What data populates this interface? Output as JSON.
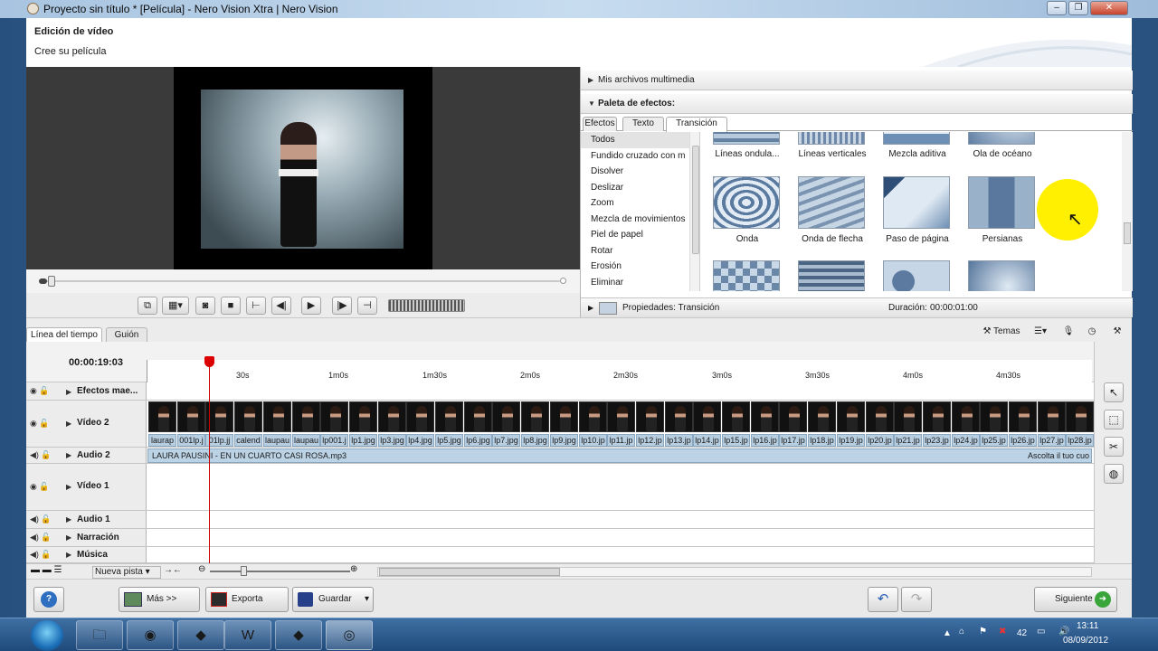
{
  "window": {
    "title": "Proyecto sin título * [Película] - Nero Vision Xtra | Nero Vision"
  },
  "header": {
    "title": "Edición de vídeo",
    "subtitle": "Cree su película"
  },
  "media_panel": {
    "label": "Mis archivos multimedia"
  },
  "effects": {
    "label": "Paleta de efectos:",
    "tabs": [
      "Efectos",
      "Texto",
      "Transición"
    ],
    "active_tab": "Transición",
    "categories": [
      "Todos",
      "Fundido cruzado con m",
      "Disolver",
      "Deslizar",
      "Zoom",
      "Mezcla de movimientos",
      "Piel de papel",
      "Rotar",
      "Erosión",
      "Eliminar"
    ],
    "selected_category": "Todos",
    "row1": [
      "Líneas ondula...",
      "Líneas verticales",
      "Mezcla aditiva",
      "Ola de océano"
    ],
    "row2": [
      "Onda",
      "Onda de flecha",
      "Paso de página",
      "Persianas"
    ]
  },
  "properties": {
    "label": "Propiedades: Transición",
    "duration_label": "Duración:",
    "duration_value": "00:00:01:00"
  },
  "timeline": {
    "tabs": [
      "Línea del tiempo",
      "Guión"
    ],
    "active_tab": "Línea del tiempo",
    "themes_label": "Temas",
    "timecode": "00:00:19:03",
    "marks": [
      "30s",
      "1m0s",
      "1m30s",
      "2m0s",
      "2m30s",
      "3m0s",
      "3m30s",
      "4m0s",
      "4m30s"
    ],
    "tracks": {
      "effects": "Efectos mae...",
      "video2": "Vídeo 2",
      "audio2": "Audio 2",
      "video1": "Vídeo 1",
      "audio1": "Audio 1",
      "narracion": "Narración",
      "musica": "Música"
    },
    "clips": [
      "laurap",
      "001lp.j",
      "01lp.jj",
      "calend",
      "laupau",
      "laupau",
      "lp001.j",
      "lp1.jpg",
      "lp3.jpg",
      "lp4.jpg",
      "lp5.jpg",
      "lp6.jpg",
      "lp7.jpg",
      "lp8.jpg",
      "lp9.jpg",
      "lp10.jp",
      "lp11.jp",
      "lp12.jp",
      "lp13.jp",
      "lp14.jp",
      "lp15.jp",
      "lp16.jp",
      "lp17.jp",
      "lp18.jp",
      "lp19.jp",
      "lp20.jp",
      "lp21.jp",
      "lp23.jp",
      "lp24.jp",
      "lp25.jp",
      "lp26.jp",
      "lp27.jp",
      "lp28.jp"
    ],
    "audio_clip": "LAURA PAUSINI - EN UN CUARTO CASI ROSA.mp3",
    "audio_clip_right": "Ascolta il tuo cuo",
    "new_track_label": "Nueva pista"
  },
  "bottom": {
    "help": "?",
    "more": "Más >>",
    "export": "Exporta",
    "save": "Guardar",
    "next": "Siguiente"
  },
  "taskbar": {
    "time": "13:11",
    "date": "08/09/2012",
    "tray_num": "42"
  }
}
